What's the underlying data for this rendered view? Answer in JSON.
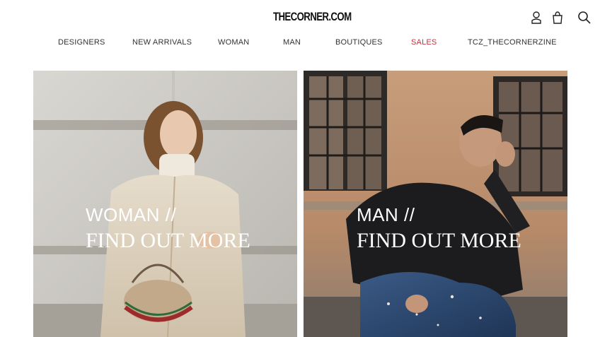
{
  "header": {
    "logo": "THECORNER.COM",
    "icons": [
      "account-icon",
      "shopping-bag-icon",
      "search-icon"
    ]
  },
  "nav": {
    "items": [
      {
        "label": "DESIGNERS"
      },
      {
        "label": "NEW ARRIVALS"
      },
      {
        "label": "WOMAN"
      },
      {
        "label": "MAN"
      },
      {
        "label": "BOUTIQUES"
      },
      {
        "label": "SALES",
        "color": "#c8323c"
      },
      {
        "label": "TCZ_THECORNERZINE"
      }
    ]
  },
  "panels": {
    "woman": {
      "title": "WOMAN //",
      "cta": "FIND OUT MORE"
    },
    "man": {
      "title": "MAN //",
      "cta": "FIND OUT MORE"
    }
  },
  "colors": {
    "accent_sales": "#c8323c",
    "text": "#333333",
    "background": "#ffffff"
  }
}
